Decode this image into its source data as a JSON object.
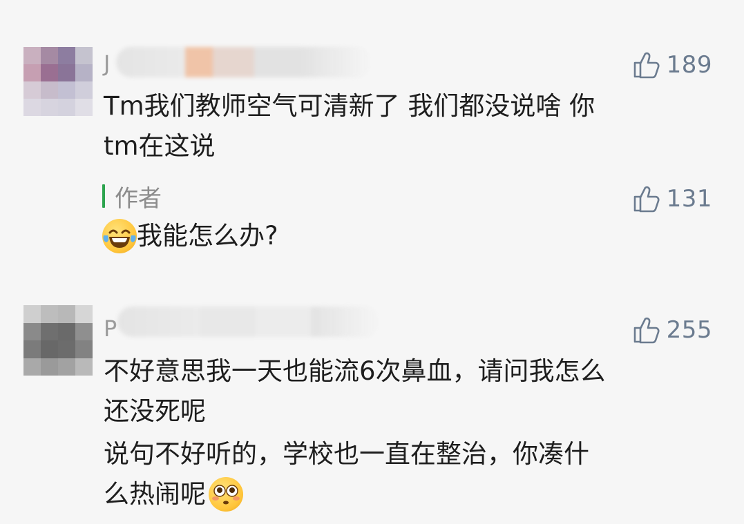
{
  "comments": [
    {
      "username_initial": "J",
      "likes": "189",
      "lines": [
        "Tm我们教师空气可清新了 我们都没说啥 你",
        "tm在这说"
      ],
      "author_reply": {
        "label": "作者",
        "likes": "131",
        "text": "我能怎么办?",
        "emoji": "laughing-tears-emoji"
      }
    },
    {
      "username_initial": "P",
      "likes": "255",
      "lines": [
        "不好意思我一天也能流6次鼻血，请问我怎么",
        "还没死呢",
        "说句不好听的，学校也一直在整治，你凑什",
        "么热闹呢"
      ],
      "trailing_emoji": "flushed-face-emoji"
    }
  ],
  "icons": {
    "like": "thumbs-up-icon"
  },
  "colors": {
    "background": "#f6f6f6",
    "author_bar": "#2da44e",
    "like_icon": "#6b7b8f"
  }
}
